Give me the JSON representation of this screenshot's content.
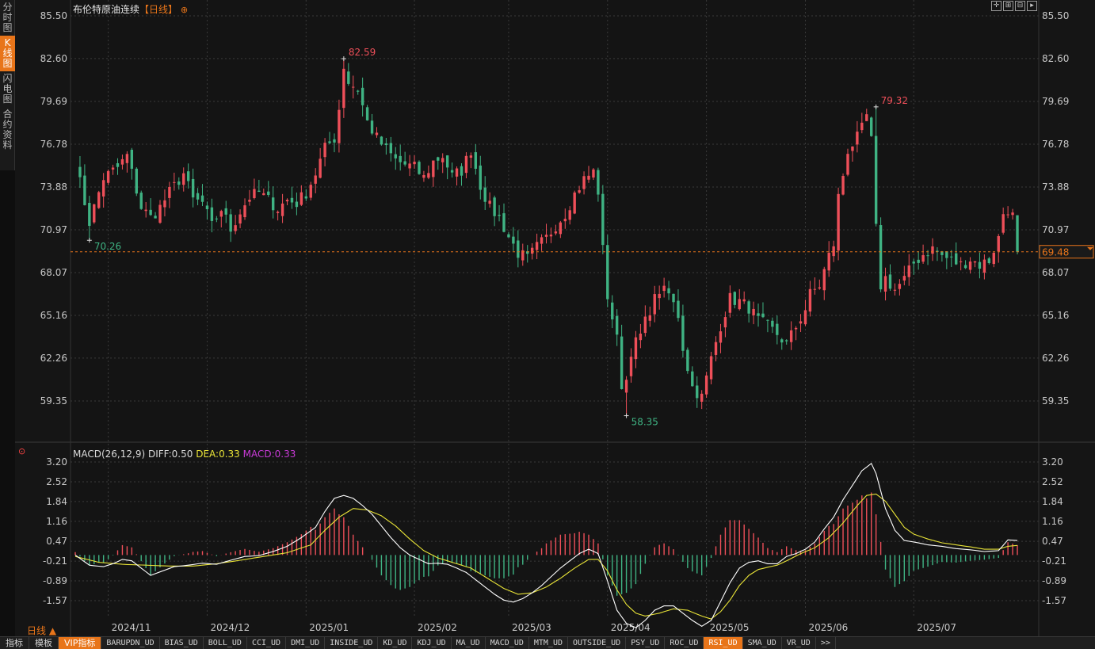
{
  "left_tabs": [
    {
      "label": "分\n时\n图",
      "active": false
    },
    {
      "label": "K\n线\n图",
      "active": true
    },
    {
      "label": "闪\n电\n图",
      "active": false
    },
    {
      "label": "合\n约\n资\n料",
      "active": false
    }
  ],
  "header": {
    "title": "布伦特原油连续",
    "period": "【日线】",
    "settings_icon": "⊕"
  },
  "toolbar_icons": [
    "crosshair-icon",
    "zoom-in-icon",
    "zoom-out-icon",
    "play-icon"
  ],
  "colors": {
    "up": "#ee4f59",
    "down": "#3fb383",
    "diff": "#ffffff",
    "dea": "#e8e337",
    "macd": "#c73ad5",
    "accent": "#e8751a",
    "grid": "#3a3a3a"
  },
  "macd_legend": {
    "label": "MACD(26,12,9)",
    "diff": "DIFF:0.50",
    "dea": "DEA:0.33",
    "macd": "MACD:0.33"
  },
  "period_label": "日线 ▲",
  "bottom_tabs": [
    {
      "label": "指标",
      "mono": false,
      "hl": false
    },
    {
      "label": "模板",
      "mono": false,
      "hl": false
    },
    {
      "label": "VIP指标",
      "mono": false,
      "hl": true
    },
    {
      "label": "BARUPDN_UD",
      "mono": true,
      "hl": false
    },
    {
      "label": "BIAS_UD",
      "mono": true,
      "hl": false
    },
    {
      "label": "BOLL_UD",
      "mono": true,
      "hl": false
    },
    {
      "label": "CCI_UD",
      "mono": true,
      "hl": false
    },
    {
      "label": "DMI_UD",
      "mono": true,
      "hl": false
    },
    {
      "label": "INSIDE_UD",
      "mono": true,
      "hl": false
    },
    {
      "label": "KD_UD",
      "mono": true,
      "hl": false
    },
    {
      "label": "KDJ_UD",
      "mono": true,
      "hl": false
    },
    {
      "label": "MA_UD",
      "mono": true,
      "hl": false
    },
    {
      "label": "MACD_UD",
      "mono": true,
      "hl": false
    },
    {
      "label": "MTM_UD",
      "mono": true,
      "hl": false
    },
    {
      "label": "OUTSIDE_UD",
      "mono": true,
      "hl": false
    },
    {
      "label": "PSY_UD",
      "mono": true,
      "hl": false
    },
    {
      "label": "ROC_UD",
      "mono": true,
      "hl": false
    },
    {
      "label": "RSI_UD",
      "mono": true,
      "hl": true
    },
    {
      "label": "SMA_UD",
      "mono": true,
      "hl": false
    },
    {
      "label": "VR_UD",
      "mono": true,
      "hl": false
    },
    {
      "label": ">>",
      "mono": true,
      "hl": false
    }
  ],
  "chart_data": [
    {
      "type": "candlestick",
      "title": "布伦特原油连续",
      "y_ticks": [
        "85.50",
        "82.60",
        "79.69",
        "76.78",
        "73.88",
        "70.97",
        "68.07",
        "65.16",
        "62.26",
        "59.35"
      ],
      "ylim": [
        57.5,
        86.2
      ],
      "x_ticks": [
        "2024/11",
        "2024/12",
        "2025/01",
        "2025/02",
        "2025/03",
        "2025/04",
        "2025/05",
        "2025/06",
        "2025/07"
      ],
      "x_tick_index": [
        7,
        28,
        49,
        72,
        92,
        113,
        134,
        155,
        178
      ],
      "last_price": 69.48,
      "last_price_label": "69.48",
      "annotations": [
        {
          "text": "82.59",
          "value": 82.59,
          "index": 57,
          "kind": "high"
        },
        {
          "text": "70.26",
          "value": 70.26,
          "index": 3,
          "kind": "low"
        },
        {
          "text": "79.32",
          "value": 79.32,
          "index": 170,
          "kind": "high"
        },
        {
          "text": "58.35",
          "value": 58.35,
          "index": 117,
          "kind": "low"
        }
      ],
      "close_path": [
        [
          0,
          75.5
        ],
        [
          3,
          71.5
        ],
        [
          6,
          74.5
        ],
        [
          9,
          75.2
        ],
        [
          11,
          76.0
        ],
        [
          14,
          72.5
        ],
        [
          16,
          71.8
        ],
        [
          18,
          72.5
        ],
        [
          20,
          73.5
        ],
        [
          23,
          74.8
        ],
        [
          25,
          73.0
        ],
        [
          27,
          72.8
        ],
        [
          29,
          71.2
        ],
        [
          31,
          72.4
        ],
        [
          33,
          71.0
        ],
        [
          35,
          72.2
        ],
        [
          37,
          73.2
        ],
        [
          39,
          73.5
        ],
        [
          41,
          73.0
        ],
        [
          43,
          72.4
        ],
        [
          45,
          73.0
        ],
        [
          47,
          72.8
        ],
        [
          49,
          73.5
        ],
        [
          51,
          74.8
        ],
        [
          53,
          76.5
        ],
        [
          55,
          77.2
        ],
        [
          56,
          79.2
        ],
        [
          57,
          82.1
        ],
        [
          58,
          81.0
        ],
        [
          60,
          80.5
        ],
        [
          62,
          78.3
        ],
        [
          64,
          77.2
        ],
        [
          66,
          76.4
        ],
        [
          68,
          75.7
        ],
        [
          70,
          75.4
        ],
        [
          72,
          75.2
        ],
        [
          74,
          74.5
        ],
        [
          76,
          75.6
        ],
        [
          78,
          76.0
        ],
        [
          80,
          74.6
        ],
        [
          82,
          75.0
        ],
        [
          84,
          76.4
        ],
        [
          86,
          74.0
        ],
        [
          88,
          72.5
        ],
        [
          90,
          71.8
        ],
        [
          92,
          70.5
        ],
        [
          94,
          69.4
        ],
        [
          96,
          69.0
        ],
        [
          98,
          69.8
        ],
        [
          100,
          70.4
        ],
        [
          102,
          71.3
        ],
        [
          104,
          72.1
        ],
        [
          106,
          73.4
        ],
        [
          108,
          74.4
        ],
        [
          110,
          74.9
        ],
        [
          111,
          73.6
        ],
        [
          112,
          69.6
        ],
        [
          113,
          66.5
        ],
        [
          115,
          63.5
        ],
        [
          116,
          60.5
        ],
        [
          117,
          60.8
        ],
        [
          118,
          62.8
        ],
        [
          120,
          63.8
        ],
        [
          122,
          65.6
        ],
        [
          124,
          66.9
        ],
        [
          126,
          66.6
        ],
        [
          128,
          65.2
        ],
        [
          129,
          63.0
        ],
        [
          131,
          60.3
        ],
        [
          133,
          59.6
        ],
        [
          135,
          62.2
        ],
        [
          137,
          64.5
        ],
        [
          139,
          66.3
        ],
        [
          141,
          66.1
        ],
        [
          143,
          65.7
        ],
        [
          145,
          64.8
        ],
        [
          147,
          64.4
        ],
        [
          149,
          63.9
        ],
        [
          151,
          63.2
        ],
        [
          153,
          64.4
        ],
        [
          155,
          65.6
        ],
        [
          156,
          66.6
        ],
        [
          158,
          67.2
        ],
        [
          160,
          69.2
        ],
        [
          161,
          70.0
        ],
        [
          162,
          73.2
        ],
        [
          163,
          74.7
        ],
        [
          164,
          76.4
        ],
        [
          166,
          77.2
        ],
        [
          167,
          77.8
        ],
        [
          168,
          78.7
        ],
        [
          169,
          77.0
        ],
        [
          170,
          71.0
        ],
        [
          171,
          67.2
        ],
        [
          172,
          67.7
        ],
        [
          174,
          66.9
        ],
        [
          176,
          67.6
        ],
        [
          178,
          68.7
        ],
        [
          180,
          69.3
        ],
        [
          182,
          69.7
        ],
        [
          184,
          69.2
        ],
        [
          186,
          68.9
        ],
        [
          188,
          68.6
        ],
        [
          190,
          69.0
        ],
        [
          192,
          68.6
        ],
        [
          194,
          68.9
        ],
        [
          196,
          70.4
        ],
        [
          197,
          72.1
        ],
        [
          198,
          72.4
        ],
        [
          199,
          71.9
        ],
        [
          200,
          69.48
        ]
      ]
    },
    {
      "type": "macd",
      "title": "MACD(26,12,9)",
      "y_ticks": [
        "3.20",
        "2.52",
        "1.84",
        "1.16",
        "0.47",
        "-0.21",
        "-0.89",
        "-1.57"
      ],
      "ylim": [
        -2.5,
        3.5
      ],
      "diff_path": [
        [
          0,
          0.0
        ],
        [
          3,
          -0.35
        ],
        [
          6,
          -0.4
        ],
        [
          8,
          -0.3
        ],
        [
          10,
          -0.15
        ],
        [
          12,
          -0.2
        ],
        [
          14,
          -0.45
        ],
        [
          16,
          -0.7
        ],
        [
          18,
          -0.58
        ],
        [
          21,
          -0.4
        ],
        [
          24,
          -0.35
        ],
        [
          27,
          -0.28
        ],
        [
          30,
          -0.32
        ],
        [
          33,
          -0.18
        ],
        [
          36,
          -0.05
        ],
        [
          39,
          -0.02
        ],
        [
          42,
          0.12
        ],
        [
          45,
          0.3
        ],
        [
          48,
          0.6
        ],
        [
          51,
          0.95
        ],
        [
          53,
          1.5
        ],
        [
          55,
          1.95
        ],
        [
          57,
          2.05
        ],
        [
          59,
          1.95
        ],
        [
          61,
          1.7
        ],
        [
          63,
          1.4
        ],
        [
          65,
          1.0
        ],
        [
          67,
          0.6
        ],
        [
          69,
          0.25
        ],
        [
          71,
          0.0
        ],
        [
          73,
          -0.15
        ],
        [
          75,
          -0.3
        ],
        [
          77,
          -0.28
        ],
        [
          79,
          -0.32
        ],
        [
          81,
          -0.45
        ],
        [
          83,
          -0.6
        ],
        [
          85,
          -0.85
        ],
        [
          87,
          -1.1
        ],
        [
          89,
          -1.35
        ],
        [
          91,
          -1.55
        ],
        [
          93,
          -1.62
        ],
        [
          95,
          -1.5
        ],
        [
          97,
          -1.3
        ],
        [
          99,
          -1.05
        ],
        [
          101,
          -0.75
        ],
        [
          103,
          -0.45
        ],
        [
          105,
          -0.2
        ],
        [
          107,
          0.05
        ],
        [
          109,
          0.2
        ],
        [
          111,
          0.05
        ],
        [
          113,
          -0.9
        ],
        [
          115,
          -1.9
        ],
        [
          117,
          -2.35
        ],
        [
          119,
          -2.5
        ],
        [
          121,
          -2.25
        ],
        [
          123,
          -1.9
        ],
        [
          125,
          -1.75
        ],
        [
          127,
          -1.75
        ],
        [
          129,
          -2.0
        ],
        [
          131,
          -2.25
        ],
        [
          133,
          -2.45
        ],
        [
          135,
          -2.25
        ],
        [
          137,
          -1.6
        ],
        [
          139,
          -0.95
        ],
        [
          141,
          -0.45
        ],
        [
          143,
          -0.25
        ],
        [
          145,
          -0.2
        ],
        [
          147,
          -0.3
        ],
        [
          149,
          -0.3
        ],
        [
          151,
          -0.05
        ],
        [
          153,
          0.05
        ],
        [
          155,
          0.2
        ],
        [
          157,
          0.45
        ],
        [
          159,
          0.9
        ],
        [
          161,
          1.3
        ],
        [
          163,
          1.9
        ],
        [
          165,
          2.4
        ],
        [
          167,
          2.9
        ],
        [
          169,
          3.15
        ],
        [
          170,
          2.8
        ],
        [
          172,
          1.6
        ],
        [
          174,
          0.85
        ],
        [
          176,
          0.5
        ],
        [
          178,
          0.45
        ],
        [
          181,
          0.35
        ],
        [
          184,
          0.3
        ],
        [
          187,
          0.22
        ],
        [
          190,
          0.18
        ],
        [
          193,
          0.12
        ],
        [
          196,
          0.15
        ],
        [
          198,
          0.52
        ],
        [
          200,
          0.5
        ]
      ],
      "dea_path": [
        [
          0,
          -0.05
        ],
        [
          5,
          -0.25
        ],
        [
          10,
          -0.32
        ],
        [
          15,
          -0.35
        ],
        [
          20,
          -0.38
        ],
        [
          25,
          -0.38
        ],
        [
          30,
          -0.3
        ],
        [
          35,
          -0.18
        ],
        [
          40,
          -0.05
        ],
        [
          45,
          0.08
        ],
        [
          50,
          0.35
        ],
        [
          53,
          0.85
        ],
        [
          56,
          1.3
        ],
        [
          59,
          1.6
        ],
        [
          62,
          1.55
        ],
        [
          65,
          1.35
        ],
        [
          68,
          1.0
        ],
        [
          71,
          0.55
        ],
        [
          74,
          0.15
        ],
        [
          77,
          -0.1
        ],
        [
          80,
          -0.25
        ],
        [
          84,
          -0.45
        ],
        [
          88,
          -0.85
        ],
        [
          91,
          -1.15
        ],
        [
          94,
          -1.35
        ],
        [
          97,
          -1.3
        ],
        [
          100,
          -1.1
        ],
        [
          103,
          -0.8
        ],
        [
          106,
          -0.45
        ],
        [
          109,
          -0.15
        ],
        [
          111,
          -0.15
        ],
        [
          113,
          -0.55
        ],
        [
          115,
          -1.2
        ],
        [
          117,
          -1.7
        ],
        [
          119,
          -2.0
        ],
        [
          121,
          -2.1
        ],
        [
          124,
          -2.0
        ],
        [
          127,
          -1.85
        ],
        [
          130,
          -1.9
        ],
        [
          133,
          -2.1
        ],
        [
          135,
          -2.2
        ],
        [
          137,
          -1.95
        ],
        [
          139,
          -1.55
        ],
        [
          141,
          -1.05
        ],
        [
          143,
          -0.7
        ],
        [
          145,
          -0.5
        ],
        [
          147,
          -0.42
        ],
        [
          149,
          -0.35
        ],
        [
          151,
          -0.2
        ],
        [
          154,
          0.05
        ],
        [
          157,
          0.25
        ],
        [
          160,
          0.6
        ],
        [
          163,
          1.1
        ],
        [
          166,
          1.7
        ],
        [
          168,
          2.05
        ],
        [
          170,
          2.1
        ],
        [
          172,
          1.85
        ],
        [
          174,
          1.4
        ],
        [
          176,
          0.95
        ],
        [
          178,
          0.72
        ],
        [
          181,
          0.55
        ],
        [
          184,
          0.42
        ],
        [
          187,
          0.35
        ],
        [
          190,
          0.28
        ],
        [
          193,
          0.2
        ],
        [
          196,
          0.2
        ],
        [
          198,
          0.3
        ],
        [
          200,
          0.33
        ]
      ]
    }
  ]
}
